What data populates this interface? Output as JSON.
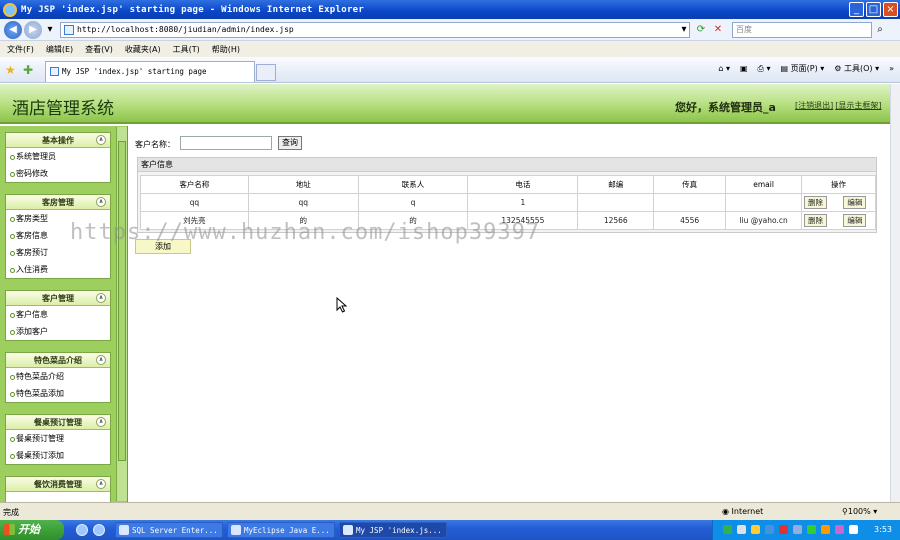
{
  "window": {
    "title": "My JSP 'index.jsp' starting page - Windows Internet Explorer"
  },
  "browser": {
    "address": "http://localhost:8080/jiudian/admin/index.jsp",
    "search_placeholder": "百度",
    "menu": [
      "文件(F)",
      "编辑(E)",
      "查看(V)",
      "收藏夹(A)",
      "工具(T)",
      "帮助(H)"
    ],
    "tab_title": "My JSP 'index.jsp' starting page",
    "tools_page": "页面(P)",
    "tools_tools": "工具(O)"
  },
  "header": {
    "system_title": "酒店管理系统",
    "welcome": "您好，系统管理员_a",
    "logout": "[注销退出]",
    "home": "[显示主框架]"
  },
  "sidebar": {
    "groups": [
      {
        "title": "基本操作",
        "items": [
          "系统管理员",
          "密码修改"
        ]
      },
      {
        "title": "客房管理",
        "items": [
          "客房类型",
          "客房信息",
          "客房预订",
          "入住消费"
        ]
      },
      {
        "title": "客户管理",
        "items": [
          "客户信息",
          "添加客户"
        ]
      },
      {
        "title": "特色菜品介绍",
        "items": [
          "特色菜品介绍",
          "特色菜品添加"
        ]
      },
      {
        "title": "餐桌预订管理",
        "items": [
          "餐桌预订管理",
          "餐桌预订添加"
        ]
      },
      {
        "title": "餐饮消费管理",
        "items": []
      }
    ]
  },
  "main": {
    "search_label": "客户名称：",
    "search_button": "查询",
    "panel_title": "客户信息",
    "columns": [
      "客户名称",
      "地址",
      "联系人",
      "电话",
      "邮编",
      "传真",
      "email",
      "操作"
    ],
    "rows": [
      {
        "name": "qq",
        "address": "qq",
        "contact": "q",
        "phone": "1",
        "zip": "",
        "fax": "",
        "email": ""
      },
      {
        "name": "刘先亮",
        "address": "的",
        "contact": "的",
        "phone": "132545555",
        "zip": "12566",
        "fax": "4556",
        "email": "liu @yaho.cn"
      }
    ],
    "delete_label": "删除",
    "edit_label": "编辑",
    "add_button": "添加"
  },
  "watermark": "https://www.huzhan.com/ishop39397",
  "statusbar": {
    "status": "完成",
    "zone": "Internet",
    "zoom": "100%"
  },
  "taskbar": {
    "start": "开始",
    "tasks": [
      "SQL Server Enter...",
      "MyEclipse Java E...",
      "My JSP 'index.js..."
    ],
    "clock": "3:53"
  }
}
